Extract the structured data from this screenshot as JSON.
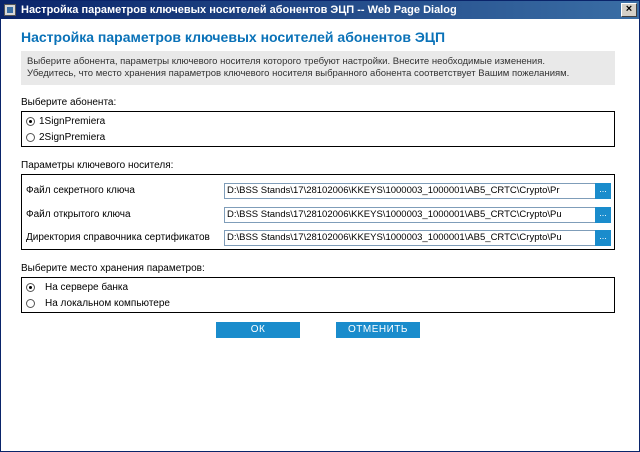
{
  "window": {
    "title": "Настройка параметров ключевых носителей абонентов ЭЦП -- Web Page Dialog",
    "close_label": "×"
  },
  "heading": "Настройка параметров ключевых носителей абонентов ЭЦП",
  "info": {
    "line1": "Выберите абонента, параметры ключевого носителя которого требуют настройки. Внесите необходимые изменения.",
    "line2": "Убедитесь, что место хранения параметров ключевого носителя выбранного абонента соответствует Вашим пожеланиям."
  },
  "subscriber": {
    "label": "Выберите абонента:",
    "options": [
      {
        "label": "1SignPremiera",
        "checked": true
      },
      {
        "label": "2SignPremiera",
        "checked": false
      }
    ]
  },
  "key_params": {
    "label": "Параметры ключевого носителя:",
    "fields": [
      {
        "label": "Файл секретного ключа",
        "value": "D:\\BSS Stands\\17\\28102006\\KKEYS\\1000003_1000001\\AB5_CRTC\\Crypto\\Pr",
        "browse": "..."
      },
      {
        "label": "Файл открытого ключа",
        "value": "D:\\BSS Stands\\17\\28102006\\KKEYS\\1000003_1000001\\AB5_CRTC\\Crypto\\Pu",
        "browse": "..."
      },
      {
        "label": "Директория справочника сертификатов",
        "value": "D:\\BSS Stands\\17\\28102006\\KKEYS\\1000003_1000001\\AB5_CRTC\\Crypto\\Pu",
        "browse": "..."
      }
    ]
  },
  "storage": {
    "label": "Выберите место хранения параметров:",
    "options": [
      {
        "label": "На сервере банка",
        "checked": true
      },
      {
        "label": "На локальном компьютере",
        "checked": false
      }
    ]
  },
  "buttons": {
    "ok": "ОК",
    "cancel": "ОТМЕНИТЬ"
  },
  "colors": {
    "heading": "#0a72b8",
    "button": "#1a8ccc",
    "titlebar": "#0a246a"
  }
}
